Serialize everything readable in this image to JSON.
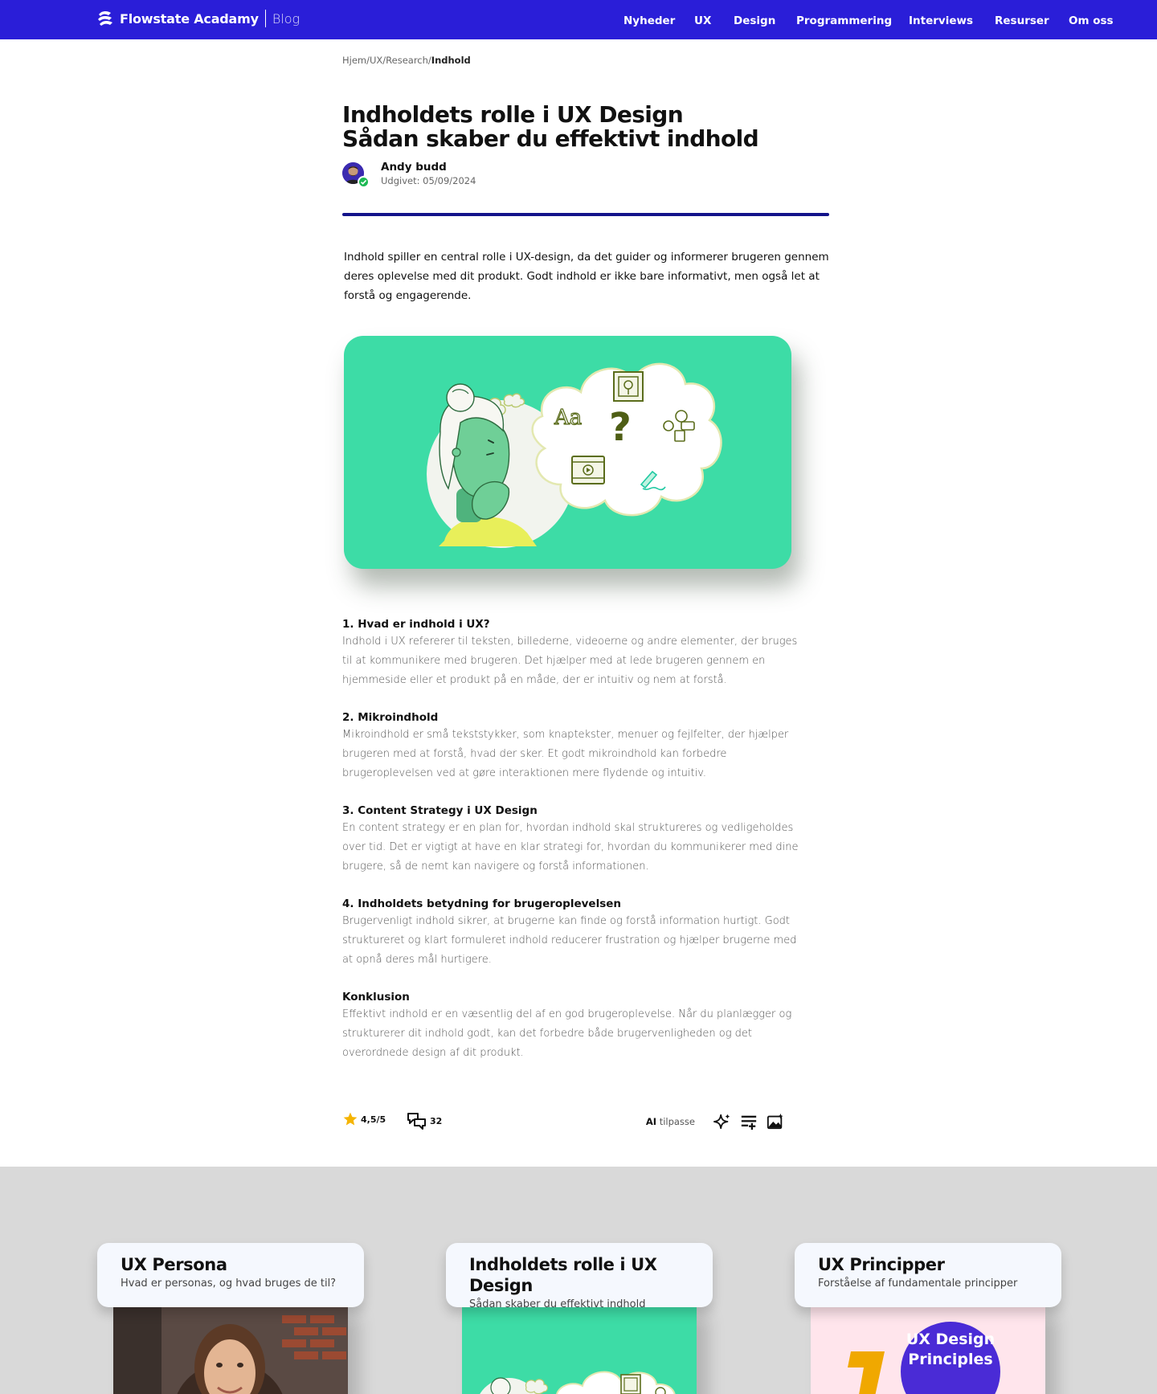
{
  "header": {
    "brand": "Flowstate Acadamy",
    "section": "Blog",
    "nav": [
      "Nyheder",
      "UX",
      "Design",
      "Programmering",
      "Interviews",
      "Resurser",
      "Om oss"
    ]
  },
  "breadcrumb": {
    "items": [
      "Hjem",
      "UX",
      "Research"
    ],
    "current": "Indhold"
  },
  "article": {
    "title_line1": "Indholdets rolle i UX Design",
    "title_line2": "Sådan skaber du effektivt indhold",
    "author": "Andy budd",
    "published": "Udgivet: 05/09/2024",
    "lead": "Indhold spiller en central rolle i UX-design, da det guider og informerer brugeren gennem deres oplevelse med dit produkt. Godt indhold er ikke bare informativt, men også let at forstå og engagerende.",
    "illustration_text": {
      "aa": "Aa",
      "question": "?"
    },
    "sections": [
      {
        "heading": "1. Hvad er indhold i UX?",
        "body": "Indhold i UX refererer til teksten, billederne, videoerne og andre elementer, der bruges til at kommunikere med brugeren. Det hjælper med at lede brugeren gennem en hjemmeside eller et produkt på en måde, der er intuitiv og nem at forstå."
      },
      {
        "heading": "2. Mikroindhold",
        "body": "Mikroindhold er små tekststykker, som knaptekster, menuer og fejlfelter, der hjælper brugeren med at forstå, hvad der sker. Et godt mikroindhold kan forbedre brugeroplevelsen ved at gøre interaktionen mere flydende og intuitiv."
      },
      {
        "heading": "3. Content Strategy i UX Design",
        "body": "En content strategy er en plan for, hvordan indhold skal struktureres og vedligeholdes over tid. Det er vigtigt at have en klar strategi for, hvordan du kommunikerer med dine brugere, så de nemt kan navigere og forstå informationen."
      },
      {
        "heading": "4. Indholdets betydning for brugeroplevelsen",
        "body": "Brugervenligt indhold sikrer, at brugerne kan finde og forstå information hurtigt. Godt struktureret og klart formuleret indhold reducerer frustration og hjælper brugerne med at opnå deres mål hurtigere."
      },
      {
        "heading": "Konklusion",
        "body": "Effektivt indhold er en væsentlig del af en god brugeroplevelse. Når du planlægger og strukturerer dit indhold godt, kan det forbedre både brugervenligheden og det overordnede design af dit produkt."
      }
    ],
    "rating": "4,5/5",
    "comments": "32",
    "ai_prefix": "AI",
    "ai_label": "tilpasse"
  },
  "related": [
    {
      "title": "UX Persona",
      "subtitle": "Hvad er personas, og hvad bruges de til?"
    },
    {
      "title": "Indholdets rolle i UX Design",
      "subtitle": "Sådan skaber du effektivt indhold"
    },
    {
      "title": "UX Principper",
      "subtitle": "Forståelse af fundamentale principper",
      "badge_line1": "UX Design",
      "badge_line2": "Principles"
    }
  ],
  "colors": {
    "header_bg": "#2a1ed8",
    "accent_divider": "#13138a",
    "hero_green": "#3ddca6",
    "related_bg": "#d9d9d9",
    "star": "#f5b400"
  }
}
